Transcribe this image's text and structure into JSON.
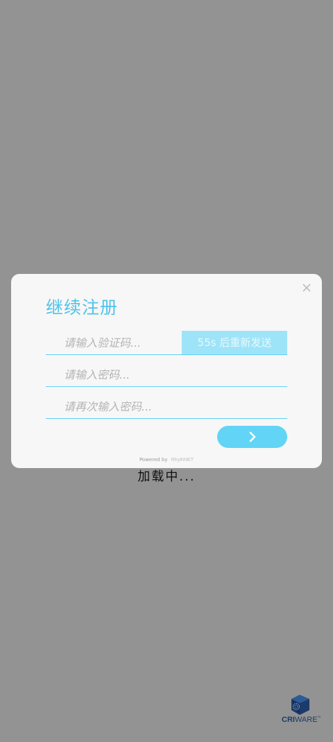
{
  "dialog": {
    "title": "继续注册",
    "code_placeholder": "请输入验证码...",
    "resend_label": "55s 后重新发送",
    "password_placeholder": "请输入密码...",
    "confirm_placeholder": "请再次输入密码...",
    "next_icon": "chevron-right-icon",
    "close_icon": "close-icon",
    "powered_prefix": "Powered by",
    "powered_brand": "RhythNET"
  },
  "loading_text": "加载中...",
  "logo": {
    "bold": "CRI",
    "light": "WARE",
    "tm": "™"
  },
  "colors": {
    "accent": "#4fc3ea",
    "button": "#62d5f7",
    "resend_bg": "#9ee4f8",
    "backdrop": "#939393"
  }
}
